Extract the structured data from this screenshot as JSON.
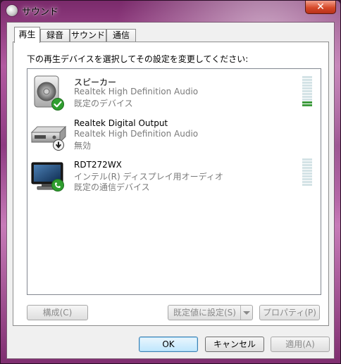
{
  "window": {
    "title": "サウンド",
    "close_glyph": "✕"
  },
  "tabs": [
    {
      "label": "再生",
      "active": true
    },
    {
      "label": "録音",
      "active": false
    },
    {
      "label": "サウンド",
      "active": false
    },
    {
      "label": "通信",
      "active": false
    }
  ],
  "instruction": "下の再生デバイスを選択してその設定を変更してください:",
  "devices": [
    {
      "name": "スピーカー",
      "driver": "Realtek High Definition Audio",
      "status": "既定のデバイス",
      "icon": "speaker-icon",
      "badge": "green-check-badge-icon"
    },
    {
      "name": "Realtek Digital Output",
      "driver": "Realtek High Definition Audio",
      "status": "無効",
      "icon": "digital-output-icon",
      "badge": "disabled-arrow-badge-icon"
    },
    {
      "name": "RDT272WX",
      "driver": "インテル(R) ディスプレイ用オーディオ",
      "status": "既定の通信デバイス",
      "icon": "monitor-icon",
      "badge": "phone-badge-icon"
    }
  ],
  "buttons": {
    "configure": "構成(C)",
    "set_default": "既定値に設定(S)",
    "properties": "プロパティ(P)",
    "ok": "OK",
    "cancel": "キャンセル",
    "apply": "適用(A)"
  },
  "colors": {
    "meter_idle": "#d4e3e6",
    "meter_active": "#3c9a3c",
    "default_badge": "#2f9e2f"
  }
}
